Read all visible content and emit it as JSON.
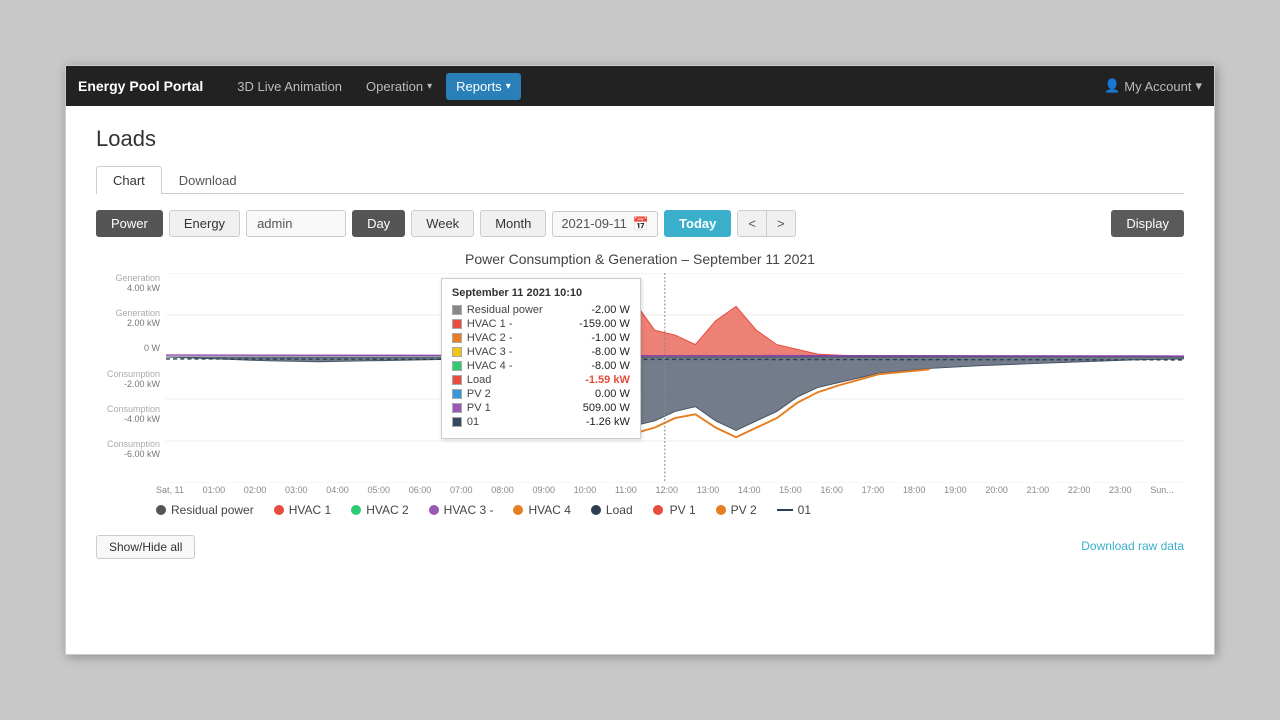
{
  "navbar": {
    "brand": "Energy Pool Portal",
    "items": [
      {
        "label": "3D Live Animation",
        "active": false,
        "hasDropdown": false
      },
      {
        "label": "Operation",
        "active": false,
        "hasDropdown": true
      },
      {
        "label": "Reports",
        "active": true,
        "hasDropdown": true
      }
    ],
    "account": "My Account"
  },
  "page": {
    "title": "Loads"
  },
  "tabs": [
    {
      "label": "Chart",
      "active": true
    },
    {
      "label": "Download",
      "active": false
    }
  ],
  "toolbar": {
    "power_label": "Power",
    "energy_label": "Energy",
    "admin_value": "admin",
    "day_label": "Day",
    "week_label": "Week",
    "month_label": "Month",
    "date_value": "2021-09-11",
    "today_label": "Today",
    "prev_label": "<",
    "next_label": ">",
    "display_label": "Display"
  },
  "chart": {
    "title": "Power Consumption & Generation – September 11 2021",
    "y_labels": [
      {
        "text": "Generation",
        "sub": "4.00 kW",
        "pos": 0
      },
      {
        "text": "Generation",
        "sub": "2.00 kW",
        "pos": 1
      },
      {
        "text": "0 W",
        "pos": 2
      },
      {
        "text": "Consumption",
        "sub": "-2.00 kW",
        "pos": 3
      },
      {
        "text": "Consumption",
        "sub": "-4.00 kW",
        "pos": 4
      },
      {
        "text": "Consumption",
        "sub": "-6.00 kW",
        "pos": 5
      }
    ],
    "x_labels": [
      "Sat, 11",
      "01:00",
      "02:00",
      "03:00",
      "04:00",
      "05:00",
      "06:00",
      "07:00",
      "08:00",
      "09:00",
      "10:00",
      "11:00",
      "12:00",
      "13:00",
      "14:00",
      "15:00",
      "16:00",
      "17:00",
      "18:00",
      "19:00",
      "20:00",
      "21:00",
      "22:00",
      "23:00",
      "Sun..."
    ]
  },
  "tooltip": {
    "title": "September 11 2021 10:10",
    "rows": [
      {
        "color": "#888",
        "label": "Residual power",
        "value": "-2.00 W"
      },
      {
        "color": "#e74c3c",
        "label": "HVAC 1 -",
        "value": "-159.00 W"
      },
      {
        "color": "#e67e22",
        "label": "HVAC 2 -",
        "value": "-1.00 W"
      },
      {
        "color": "#f1c40f",
        "label": "HVAC 3 -",
        "value": "-8.00 W"
      },
      {
        "color": "#2ecc71",
        "label": "HVAC 4 -",
        "value": "-8.00 W"
      },
      {
        "color": "#e74c3c",
        "label": "Load",
        "value": "-1.59 kW"
      },
      {
        "color": "#3498db",
        "label": "PV 2",
        "value": "0.00 W"
      },
      {
        "color": "#9b59b6",
        "label": "PV 1",
        "value": "509.00 W"
      },
      {
        "color": "#34495e",
        "label": "01",
        "value": "-1.26 kW"
      }
    ]
  },
  "legend": [
    {
      "type": "dot",
      "color": "#555",
      "label": "Residual power"
    },
    {
      "type": "dot",
      "color": "#e74c3c",
      "label": "HVAC 1"
    },
    {
      "type": "dot",
      "color": "#2ecc71",
      "label": "HVAC 2"
    },
    {
      "type": "dot",
      "color": "#9b59b6",
      "label": "HVAC 3 -"
    },
    {
      "type": "dot",
      "color": "#e67e22",
      "label": "HVAC 4"
    },
    {
      "type": "dot",
      "color": "#2c3e50",
      "label": "Load"
    },
    {
      "type": "dot",
      "color": "#e74c3c",
      "label": "PV 1"
    },
    {
      "type": "dash",
      "color": "#2c3e50",
      "label": "01"
    }
  ],
  "buttons": {
    "show_hide": "Show/Hide all",
    "download_raw": "Download raw data"
  }
}
